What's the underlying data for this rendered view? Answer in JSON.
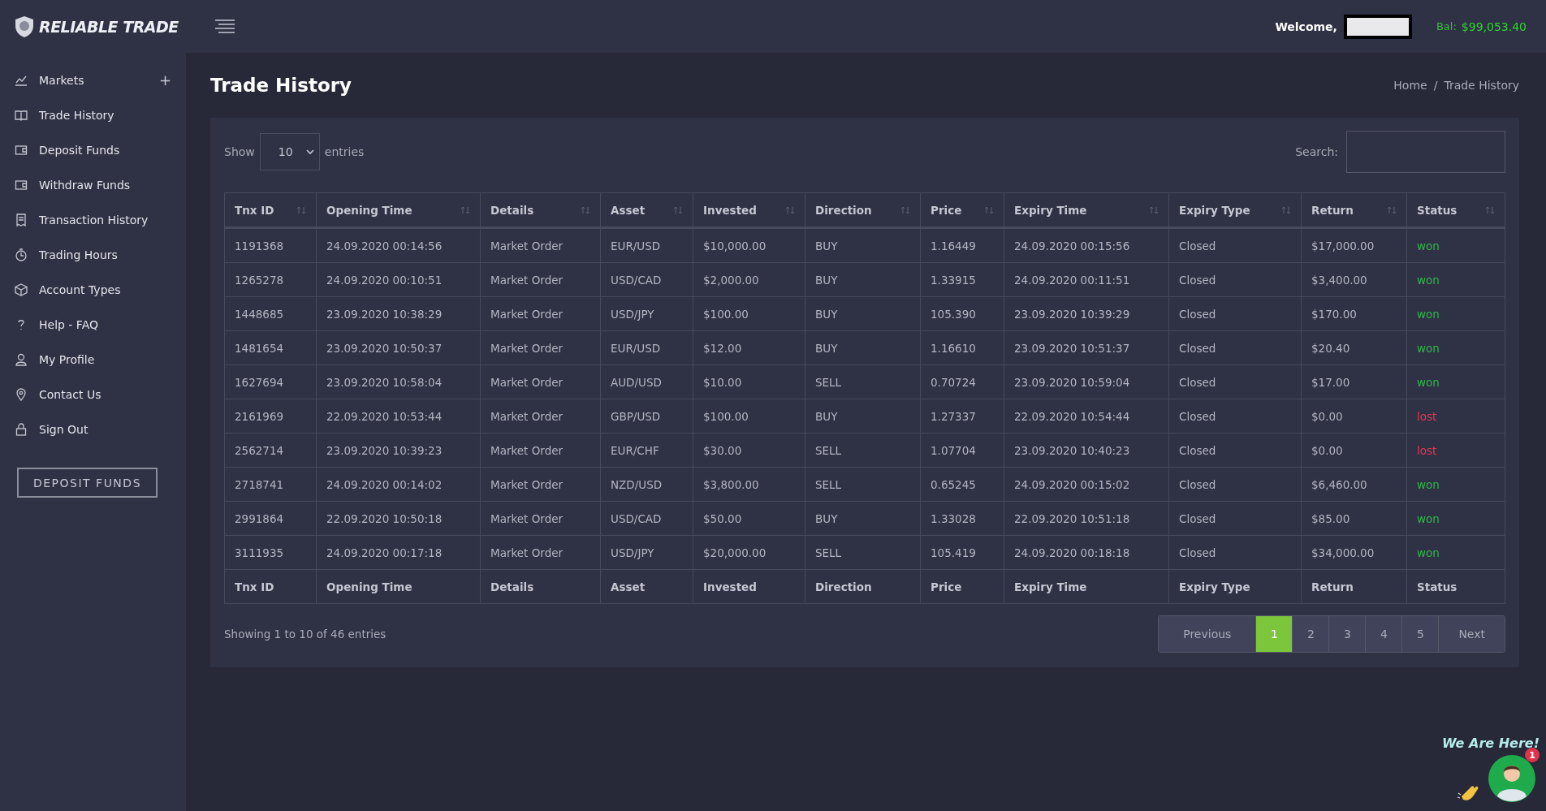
{
  "brand": {
    "name": "RELIABLE TRADE"
  },
  "header": {
    "welcome": "Welcome,",
    "balance_label": "Bal:",
    "balance": "$99,053.40"
  },
  "sidebar": {
    "items": [
      {
        "label": "Markets",
        "toggle": "+"
      },
      {
        "label": "Trade History"
      },
      {
        "label": "Deposit Funds"
      },
      {
        "label": "Withdraw Funds"
      },
      {
        "label": "Transaction History"
      },
      {
        "label": "Trading Hours"
      },
      {
        "label": "Account Types"
      },
      {
        "label": "Help - FAQ"
      },
      {
        "label": "My Profile"
      },
      {
        "label": "Contact Us"
      },
      {
        "label": "Sign Out"
      }
    ],
    "button": "DEPOSIT FUNDS"
  },
  "page": {
    "title": "Trade History",
    "breadcrumb": [
      "Home",
      "Trade History"
    ],
    "breadcrumb_separator": "/"
  },
  "table_controls": {
    "show": "Show",
    "entries_value": "10",
    "entries": "entries",
    "search_label": "Search:"
  },
  "table": {
    "columns": [
      "Tnx ID",
      "Opening Time",
      "Details",
      "Asset",
      "Invested",
      "Direction",
      "Price",
      "Expiry Time",
      "Expiry Type",
      "Return",
      "Status"
    ],
    "rows": [
      {
        "cells": [
          "1191368",
          "24.09.2020 00:14:56",
          "Market Order",
          "EUR/USD",
          "$10,000.00",
          "BUY",
          "1.16449",
          "24.09.2020 00:15:56",
          "Closed",
          "$17,000.00"
        ],
        "status": "won",
        "color": "#2fb84a"
      },
      {
        "cells": [
          "1265278",
          "24.09.2020 00:10:51",
          "Market Order",
          "USD/CAD",
          "$2,000.00",
          "BUY",
          "1.33915",
          "24.09.2020 00:11:51",
          "Closed",
          "$3,400.00"
        ],
        "status": "won",
        "color": "#2fb84a"
      },
      {
        "cells": [
          "1448685",
          "23.09.2020 10:38:29",
          "Market Order",
          "USD/JPY",
          "$100.00",
          "BUY",
          "105.390",
          "23.09.2020 10:39:29",
          "Closed",
          "$170.00"
        ],
        "status": "won",
        "color": "#2fb84a"
      },
      {
        "cells": [
          "1481654",
          "23.09.2020 10:50:37",
          "Market Order",
          "EUR/USD",
          "$12.00",
          "BUY",
          "1.16610",
          "23.09.2020 10:51:37",
          "Closed",
          "$20.40"
        ],
        "status": "won",
        "color": "#2fb84a"
      },
      {
        "cells": [
          "1627694",
          "23.09.2020 10:58:04",
          "Market Order",
          "AUD/USD",
          "$10.00",
          "SELL",
          "0.70724",
          "23.09.2020 10:59:04",
          "Closed",
          "$17.00"
        ],
        "status": "won",
        "color": "#2fb84a"
      },
      {
        "cells": [
          "2161969",
          "22.09.2020 10:53:44",
          "Market Order",
          "GBP/USD",
          "$100.00",
          "BUY",
          "1.27337",
          "22.09.2020 10:54:44",
          "Closed",
          "$0.00"
        ],
        "status": "lost",
        "color": "#e8364f"
      },
      {
        "cells": [
          "2562714",
          "23.09.2020 10:39:23",
          "Market Order",
          "EUR/CHF",
          "$30.00",
          "SELL",
          "1.07704",
          "23.09.2020 10:40:23",
          "Closed",
          "$0.00"
        ],
        "status": "lost",
        "color": "#e8364f"
      },
      {
        "cells": [
          "2718741",
          "24.09.2020 00:14:02",
          "Market Order",
          "NZD/USD",
          "$3,800.00",
          "SELL",
          "0.65245",
          "24.09.2020 00:15:02",
          "Closed",
          "$6,460.00"
        ],
        "status": "won",
        "color": "#2fb84a"
      },
      {
        "cells": [
          "2991864",
          "22.09.2020 10:50:18",
          "Market Order",
          "USD/CAD",
          "$50.00",
          "BUY",
          "1.33028",
          "22.09.2020 10:51:18",
          "Closed",
          "$85.00"
        ],
        "status": "won",
        "color": "#2fb84a"
      },
      {
        "cells": [
          "3111935",
          "24.09.2020 00:17:18",
          "Market Order",
          "USD/JPY",
          "$20,000.00",
          "SELL",
          "105.419",
          "24.09.2020 00:18:18",
          "Closed",
          "$34,000.00"
        ],
        "status": "won",
        "color": "#2fb84a"
      }
    ],
    "footer": [
      "Tnx ID",
      "Opening Time",
      "Details",
      "Asset",
      "Invested",
      "Direction",
      "Price",
      "Expiry Time",
      "Expiry Type",
      "Return",
      "Status"
    ]
  },
  "info": "Showing 1 to 10 of 46 entries",
  "pagination": {
    "previous": "Previous",
    "next": "Next",
    "pages": [
      {
        "label": "1",
        "selected": true
      },
      {
        "label": "2",
        "selected": false
      },
      {
        "label": "3",
        "selected": false
      },
      {
        "label": "4",
        "selected": false
      },
      {
        "label": "5",
        "selected": false
      }
    ]
  },
  "chat_widget": {
    "caption": "We Are Here!",
    "badge": "1"
  }
}
